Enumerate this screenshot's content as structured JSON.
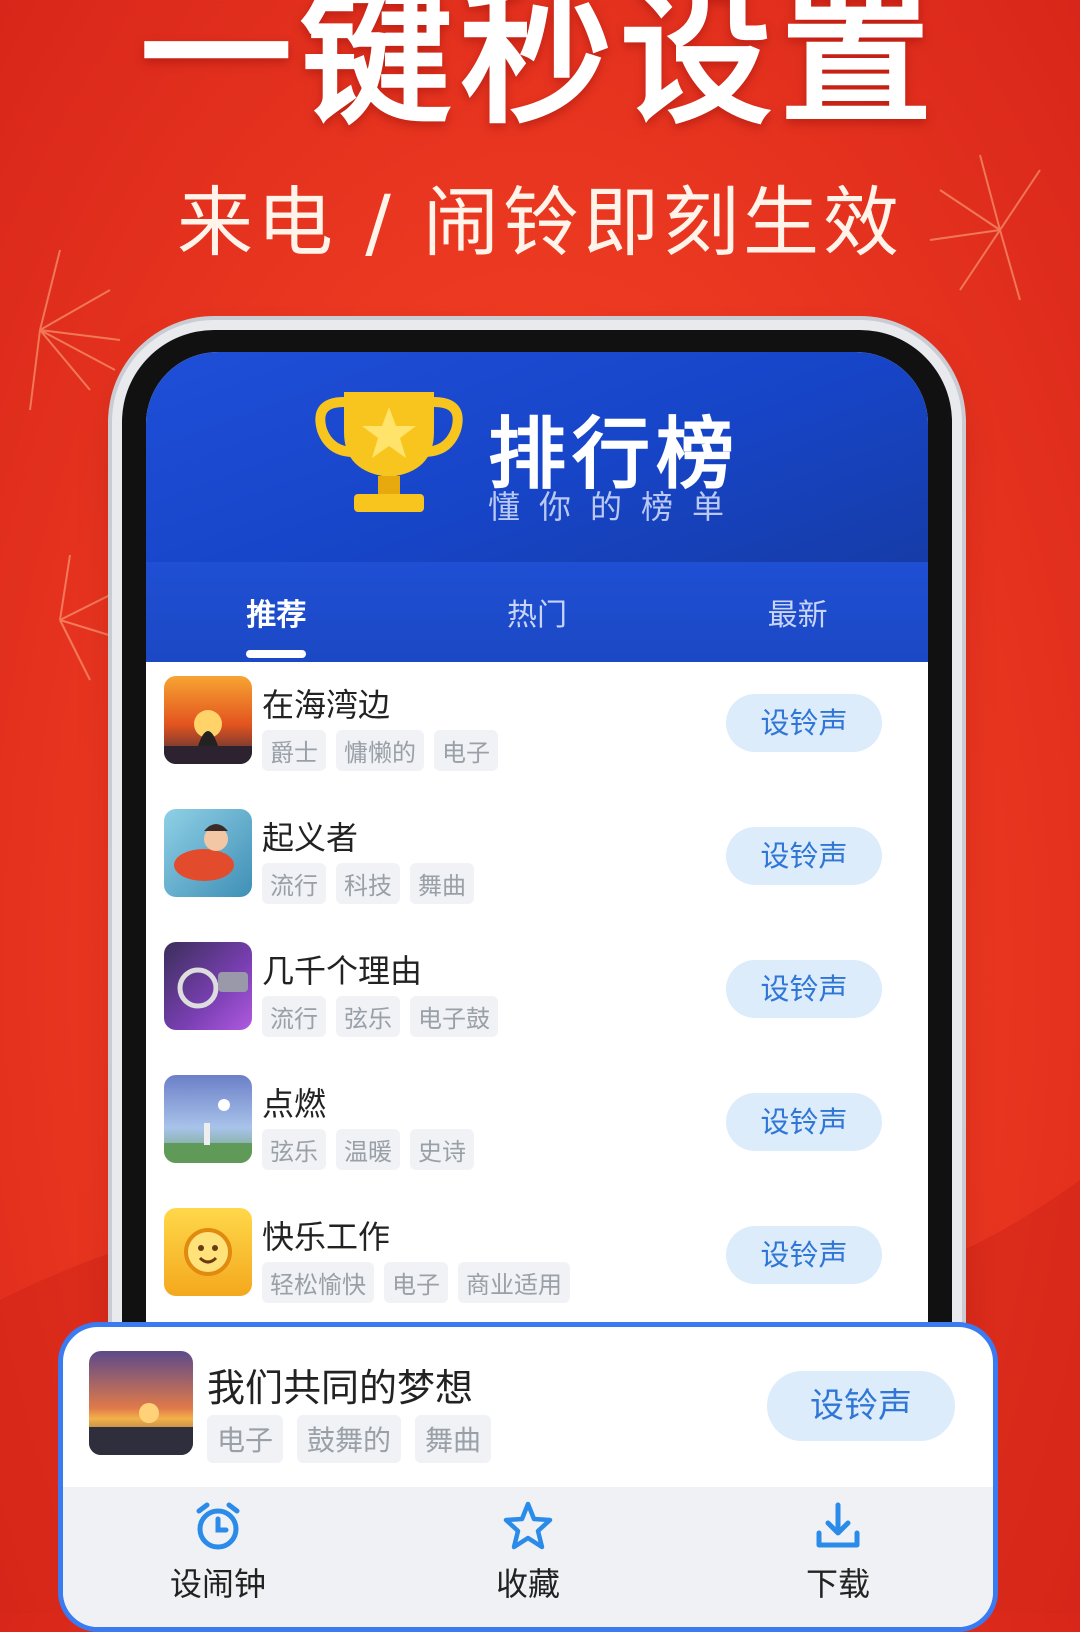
{
  "promo": {
    "headline": "一键秒设置",
    "subheadline": "来电 / 闹铃即刻生效"
  },
  "hero": {
    "title": "排行榜",
    "subtitle": "懂你的榜单"
  },
  "tabs": [
    {
      "label": "推荐",
      "active": true
    },
    {
      "label": "热门",
      "active": false
    },
    {
      "label": "最新",
      "active": false
    }
  ],
  "songs": [
    {
      "title": "在海湾边",
      "tags": [
        "爵士",
        "慵懒的",
        "电子"
      ],
      "button": "设铃声"
    },
    {
      "title": "起义者",
      "tags": [
        "流行",
        "科技",
        "舞曲"
      ],
      "button": "设铃声"
    },
    {
      "title": "几千个理由",
      "tags": [
        "流行",
        "弦乐",
        "电子鼓"
      ],
      "button": "设铃声"
    },
    {
      "title": "点燃",
      "tags": [
        "弦乐",
        "温暖",
        "史诗"
      ],
      "button": "设铃声"
    },
    {
      "title": "快乐工作",
      "tags": [
        "轻松愉快",
        "电子",
        "商业适用"
      ],
      "button": "设铃声"
    }
  ],
  "now_playing": {
    "title": "我们共同的梦想",
    "tags": [
      "电子",
      "鼓舞的",
      "舞曲"
    ],
    "button": "设铃声"
  },
  "bottom_nav": [
    {
      "label": "设闹钟",
      "icon": "alarm-clock-icon"
    },
    {
      "label": "收藏",
      "icon": "star-icon"
    },
    {
      "label": "下载",
      "icon": "download-icon"
    }
  ],
  "colors": {
    "background": "#ee3b22",
    "hero_blue": "#1f4fd8",
    "button_bg": "#dcecfb",
    "button_text": "#2f76d6",
    "card_border": "#3a7bf2"
  }
}
